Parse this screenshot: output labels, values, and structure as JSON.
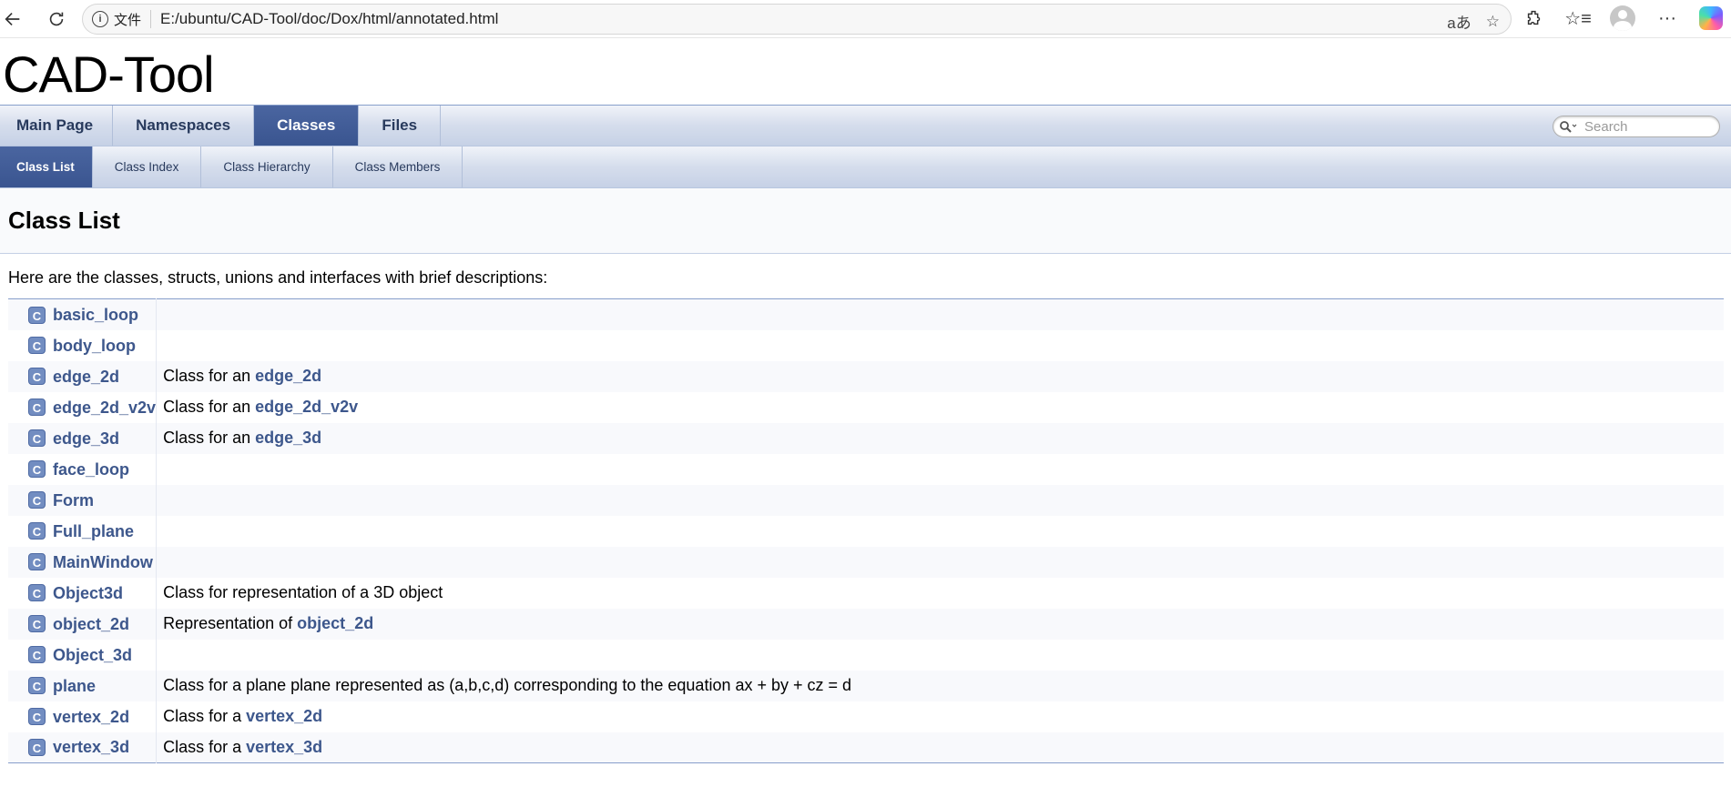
{
  "browser": {
    "file_label": "文件",
    "url": "E:/ubuntu/CAD-Tool/doc/Dox/html/annotated.html",
    "read_aloud": "aあ"
  },
  "project": {
    "title": "CAD-Tool"
  },
  "tabs": [
    {
      "label": "Main Page",
      "active": false
    },
    {
      "label": "Namespaces",
      "active": false
    },
    {
      "label": "Classes",
      "active": true
    },
    {
      "label": "Files",
      "active": false
    }
  ],
  "search": {
    "placeholder": "Search"
  },
  "subtabs": [
    {
      "label": "Class List",
      "active": true
    },
    {
      "label": "Class Index",
      "active": false
    },
    {
      "label": "Class Hierarchy",
      "active": false
    },
    {
      "label": "Class Members",
      "active": false
    }
  ],
  "page": {
    "title": "Class List",
    "intro": "Here are the classes, structs, unions and interfaces with brief descriptions:",
    "icon_letter": "C"
  },
  "classes": [
    {
      "name": "basic_loop",
      "desc": "",
      "link": ""
    },
    {
      "name": "body_loop",
      "desc": "",
      "link": ""
    },
    {
      "name": "edge_2d",
      "desc": "Class for an ",
      "link": "edge_2d"
    },
    {
      "name": "edge_2d_v2v",
      "desc": "Class for an ",
      "link": "edge_2d_v2v"
    },
    {
      "name": "edge_3d",
      "desc": "Class for an ",
      "link": "edge_3d"
    },
    {
      "name": "face_loop",
      "desc": "",
      "link": ""
    },
    {
      "name": "Form",
      "desc": "",
      "link": ""
    },
    {
      "name": "Full_plane",
      "desc": "",
      "link": ""
    },
    {
      "name": "MainWindow",
      "desc": "",
      "link": ""
    },
    {
      "name": "Object3d",
      "desc": "Class for representation of a 3D object",
      "link": ""
    },
    {
      "name": "object_2d",
      "desc": "Representation of ",
      "link": "object_2d"
    },
    {
      "name": "Object_3d",
      "desc": "",
      "link": ""
    },
    {
      "name": "plane",
      "desc": "Class for a plane plane represented as (a,b,c,d) corresponding to the equation ax + by + cz = d",
      "link": ""
    },
    {
      "name": "vertex_2d",
      "desc": "Class for a ",
      "link": "vertex_2d"
    },
    {
      "name": "vertex_3d",
      "desc": "Class for a ",
      "link": "vertex_3d"
    }
  ]
}
